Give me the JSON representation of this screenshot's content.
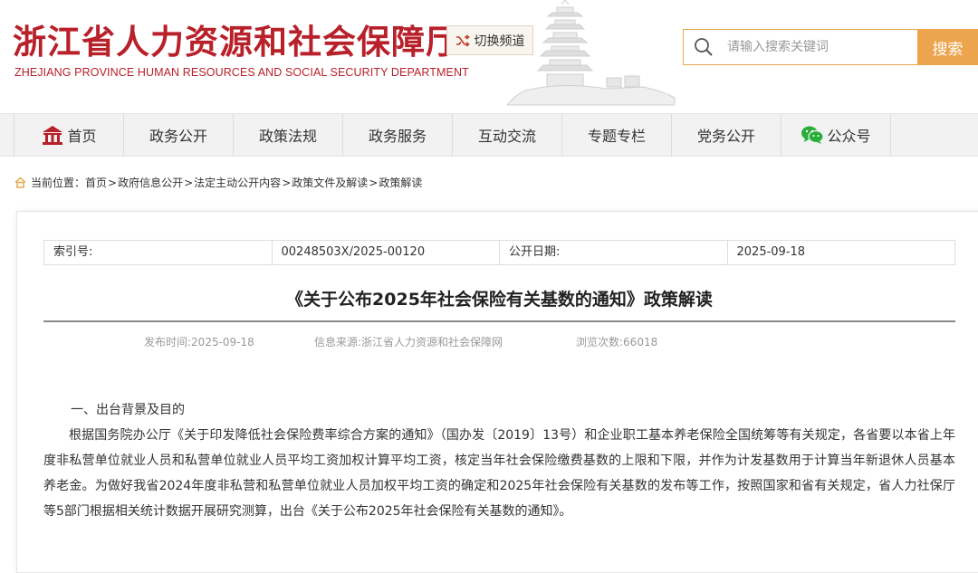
{
  "header": {
    "title_cn": "浙江省人力资源和社会保障厅",
    "title_en": "ZHEJIANG PROVINCE HUMAN RESOURCES AND SOCIAL SECURITY DEPARTMENT",
    "switch_label": "切换频道",
    "search_placeholder": "请输入搜索关键词",
    "search_button": "搜索"
  },
  "nav": {
    "items": [
      {
        "label": "首页",
        "icon": "home-icon"
      },
      {
        "label": "政务公开"
      },
      {
        "label": "政策法规"
      },
      {
        "label": "政务服务"
      },
      {
        "label": "互动交流"
      },
      {
        "label": "专题专栏"
      },
      {
        "label": "党务公开"
      },
      {
        "label": "公众号",
        "icon": "wechat-icon"
      }
    ]
  },
  "breadcrumb": {
    "prefix": "当前位置：",
    "items": [
      "首页",
      "政府信息公开",
      "法定主动公开内容",
      "政策文件及解读",
      "政策解读"
    ],
    "separator": ">"
  },
  "article": {
    "index_label": "索引号:",
    "index_value": "00248503X/2025-00120",
    "date_label": "公开日期:",
    "date_value": "2025-09-18",
    "title": "《关于公布2025年社会保险有关基数的通知》政策解读",
    "publish_time": "发布时间:2025-09-18",
    "source": "信息来源:浙江省人力资源和社会保障网",
    "views": "浏览次数:66018",
    "section1": "一、出台背景及目的",
    "para1": "根据国务院办公厅《关于印发降低社会保险费率综合方案的通知》（国办发〔2019〕13号）和企业职工基本养老保险全国统筹等有关规定，各省要以本省上年度非私营单位就业人员和私营单位就业人员平均工资加权计算平均工资，核定当年社会保险缴费基数的上限和下限，并作为计发基数用于计算当年新退休人员基本养老金。为做好我省2024年度非私营和私营单位就业人员加权平均工资的确定和2025年社会保险有关基数的发布等工作，按照国家和省有关规定，省人力社保厅等5部门根据相关统计数据开展研究测算，出台《关于公布2025年社会保险有关基数的通知》。"
  },
  "colors": {
    "brand_red": "#b8202a",
    "accent_orange": "#eca44d"
  }
}
